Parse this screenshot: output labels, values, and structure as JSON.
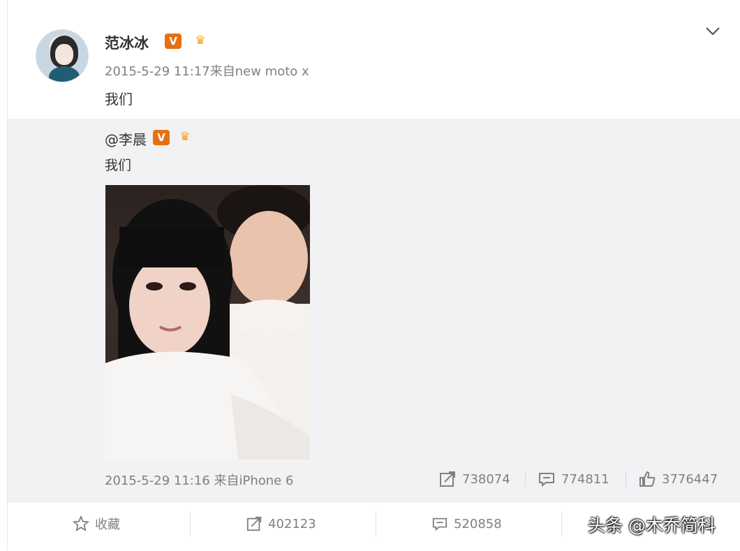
{
  "post": {
    "author": "范冰冰",
    "verified_badge": "V",
    "meta": "2015-5-29 11:17来自new moto x",
    "text": "我们"
  },
  "repost": {
    "author": "@李晨",
    "verified_badge": "V",
    "text": "我们",
    "meta": "2015-5-29 11:16 来自iPhone 6",
    "stats": {
      "shares": "738074",
      "comments": "774811",
      "likes": "3776447"
    }
  },
  "footer": {
    "favorite_label": "收藏",
    "share_count": "402123",
    "comment_count": "520858"
  },
  "watermark": "头条 @木乔简科",
  "colors": {
    "badge_orange": "#e8700e",
    "text_gray": "#808080",
    "repost_bg": "#f2f2f5"
  },
  "icons": [
    "chevron-down-icon",
    "share-icon",
    "comment-icon",
    "like-icon",
    "star-icon"
  ]
}
